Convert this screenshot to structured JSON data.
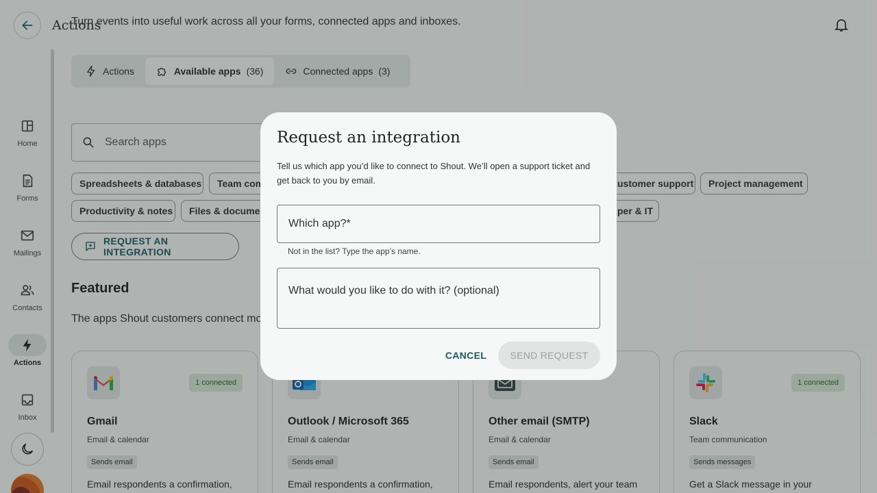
{
  "header": {
    "title": "Actions",
    "subtitle": "Turn events into useful work across all your forms, connected apps and inboxes."
  },
  "nav": {
    "items": [
      {
        "label": "Home",
        "icon": "home-icon"
      },
      {
        "label": "Forms",
        "icon": "forms-icon"
      },
      {
        "label": "Mailings",
        "icon": "mail-icon"
      },
      {
        "label": "Contacts",
        "icon": "contacts-icon"
      },
      {
        "label": "Actions",
        "icon": "bolt-icon",
        "active": true
      },
      {
        "label": "Inbox",
        "icon": "inbox-icon"
      }
    ]
  },
  "tabs": [
    {
      "label": "Actions",
      "count": ""
    },
    {
      "label": "Available apps",
      "count": "(36)"
    },
    {
      "label": "Connected apps",
      "count": "(3)"
    }
  ],
  "search": {
    "placeholder": "Search apps"
  },
  "categories": [
    "Spreadsheets & databases",
    "Team com",
    "ustomer support",
    "Project management",
    "Productivity & notes",
    "Files & documen",
    "per & IT"
  ],
  "request_button": "REQUEST AN INTEGRATION",
  "featured": {
    "title": "Featured",
    "subtitle": "The apps Shout customers connect mo"
  },
  "cards": [
    {
      "name": "Gmail",
      "category": "Email & calendar",
      "badge": "1 connected",
      "tag": "Sends email",
      "desc": "Email respondents a confirmation,"
    },
    {
      "name": "Outlook / Microsoft 365",
      "category": "Email & calendar",
      "badge": "",
      "tag": "Sends email",
      "desc": "Email respondents a confirmation,"
    },
    {
      "name": "Other email (SMTP)",
      "category": "Email & calendar",
      "badge": "",
      "tag": "Sends email",
      "desc": "Email respondents, alert your team"
    },
    {
      "name": "Slack",
      "category": "Team communication",
      "badge": "1 connected",
      "tag": "Sends messages",
      "desc": "Get a Slack message in your"
    }
  ],
  "dialog": {
    "title": "Request an integration",
    "body": "Tell us which app you’d like to connect to Shout. We’ll open a support ticket and get back to you by email.",
    "app_field": "Which app?*",
    "app_help": "Not in the list? Type the app’s name.",
    "purpose_field": "What would you like to do with it? (optional)",
    "cancel": "CANCEL",
    "send": "SEND REQUEST"
  },
  "colors": {
    "accent": "#1d5a66",
    "badge_bg": "#d4e6d6",
    "background": "#f3f6f5"
  }
}
